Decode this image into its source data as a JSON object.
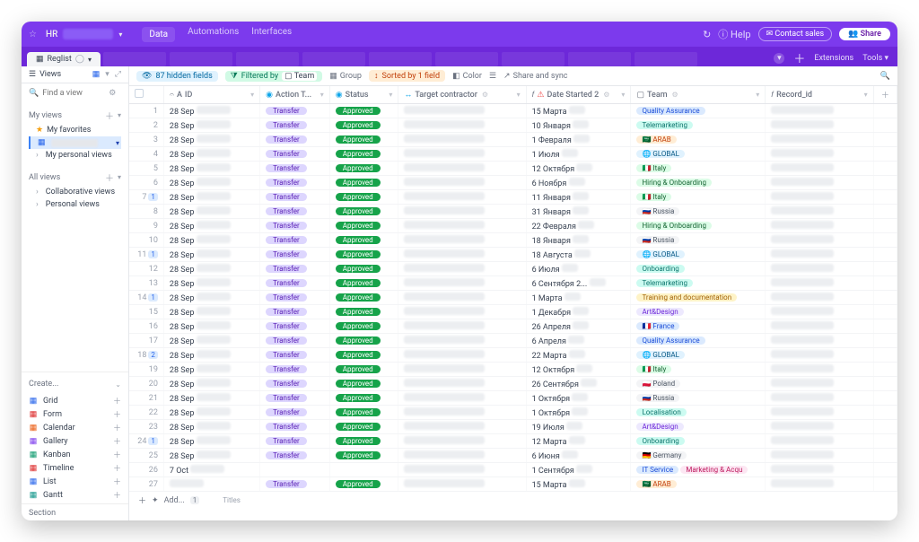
{
  "topbar": {
    "title": "HR",
    "nav": {
      "data": "Data",
      "automations": "Automations",
      "interfaces": "Interfaces"
    },
    "help": "Help",
    "contact": "Contact sales",
    "share": "Share",
    "extensions": "Extensions",
    "tools": "Tools"
  },
  "tabs": {
    "active": "Reglist"
  },
  "sidebar": {
    "views": "Views",
    "find_placeholder": "Find a view",
    "my_views": "My views",
    "my_favorites": "My favorites",
    "my_personal": "My personal views",
    "all_views": "All views",
    "collaborative": "Collaborative views",
    "personal": "Personal views",
    "create": "Create...",
    "list": [
      "Grid",
      "Form",
      "Calendar",
      "Gallery",
      "Kanban",
      "Timeline",
      "List",
      "Gantt"
    ],
    "section": "Section"
  },
  "toolbar": {
    "hidden": "87 hidden fields",
    "filtered": "Filtered by",
    "filtered_field": "Team",
    "group": "Group",
    "sorted": "Sorted by 1 field",
    "color": "Color",
    "share": "Share and sync"
  },
  "columns": {
    "id": "ID",
    "action": "Action T...",
    "status": "Status",
    "target": "Target contractor",
    "date2": "Date Started 2",
    "team": "Team",
    "record": "Record_id"
  },
  "add_label": "Add...",
  "titles_label": "Titles",
  "rows": [
    {
      "n": 1,
      "id": "28 Sep",
      "a": "Transfer",
      "s": "Approved",
      "d": "15 Марта",
      "team": "Quality Assurance",
      "tclass": "team-blue"
    },
    {
      "n": 2,
      "id": "28 Sep",
      "a": "Transfer",
      "s": "Approved",
      "d": "10 Января",
      "team": "Telemarketing",
      "tclass": "team-teal"
    },
    {
      "n": 3,
      "id": "28 Sep",
      "a": "Transfer",
      "s": "Approved",
      "d": "1 Февраля",
      "team": "ARAB",
      "flag": "🇸🇦",
      "tclass": "team-orange"
    },
    {
      "n": 4,
      "id": "28 Sep",
      "a": "Transfer",
      "s": "Approved",
      "d": "1 Июля",
      "team": "GLOBAL",
      "flag": "🌐",
      "tclass": "team-global"
    },
    {
      "n": 5,
      "id": "28 Sep",
      "a": "Transfer",
      "s": "Approved",
      "d": "12 Октября",
      "team": "Italy",
      "flag": "🇮🇹",
      "tclass": "team-green"
    },
    {
      "n": 6,
      "id": "28 Sep",
      "a": "Transfer",
      "s": "Approved",
      "d": "6 Ноября",
      "team": "Hiring & Onboarding",
      "tclass": "team-green"
    },
    {
      "n": 7,
      "b": 1,
      "id": "28 Sep",
      "a": "Transfer",
      "s": "Approved",
      "d": "11 Января",
      "team": "Italy",
      "flag": "🇮🇹",
      "tclass": "team-green"
    },
    {
      "n": 8,
      "id": "28 Sep",
      "a": "Transfer",
      "s": "Approved",
      "d": "31 Января",
      "team": "Russia",
      "flag": "🇷🇺",
      "tclass": "team-gray"
    },
    {
      "n": 9,
      "id": "28 Sep",
      "a": "Transfer",
      "s": "Approved",
      "d": "22 Февраля",
      "team": "Hiring & Onboarding",
      "tclass": "team-green"
    },
    {
      "n": 10,
      "id": "28 Sep",
      "a": "Transfer",
      "s": "Approved",
      "d": "18 Января",
      "team": "Russia",
      "flag": "🇷🇺",
      "tclass": "team-gray"
    },
    {
      "n": 11,
      "b": 1,
      "id": "28 Sep",
      "a": "Transfer",
      "s": "Approved",
      "d": "18 Августа",
      "team": "GLOBAL",
      "flag": "🌐",
      "tclass": "team-global"
    },
    {
      "n": 12,
      "id": "28 Sep",
      "a": "Transfer",
      "s": "Approved",
      "d": "6 Июля",
      "team": "Onboarding",
      "tclass": "team-teal"
    },
    {
      "n": 13,
      "id": "28 Sep",
      "a": "Transfer",
      "s": "Approved",
      "d": "6 Сентября 2...",
      "team": "Telemarketing",
      "tclass": "team-teal"
    },
    {
      "n": 14,
      "b": 1,
      "id": "28 Sep",
      "a": "Transfer",
      "s": "Approved",
      "d": "1 Марта",
      "team": "Training and documentation",
      "tclass": "team-yellow"
    },
    {
      "n": 15,
      "id": "28 Sep",
      "a": "Transfer",
      "s": "Approved",
      "d": "1 Декабря",
      "team": "Art&Design",
      "tclass": "team-purple"
    },
    {
      "n": 16,
      "id": "28 Sep",
      "a": "Transfer",
      "s": "Approved",
      "d": "26 Апреля",
      "team": "France",
      "flag": "🇫🇷",
      "tclass": "team-blue"
    },
    {
      "n": 17,
      "id": "28 Sep",
      "a": "Transfer",
      "s": "Approved",
      "d": "6 Апреля",
      "team": "Quality Assurance",
      "tclass": "team-blue"
    },
    {
      "n": 18,
      "b": 2,
      "id": "28 Sep",
      "a": "Transfer",
      "s": "Approved",
      "d": "22 Марта",
      "team": "GLOBAL",
      "flag": "🌐",
      "tclass": "team-global"
    },
    {
      "n": 19,
      "id": "28 Sep",
      "a": "Transfer",
      "s": "Approved",
      "d": "12 Октября",
      "team": "Italy",
      "flag": "🇮🇹",
      "tclass": "team-green"
    },
    {
      "n": 20,
      "id": "28 Sep",
      "a": "Transfer",
      "s": "Approved",
      "d": "26 Сентября",
      "team": "Poland",
      "flag": "🇵🇱",
      "tclass": "team-gray"
    },
    {
      "n": 21,
      "id": "28 Sep",
      "a": "Transfer",
      "s": "Approved",
      "d": "1 Октября",
      "team": "Russia",
      "flag": "🇷🇺",
      "tclass": "team-gray"
    },
    {
      "n": 22,
      "id": "28 Sep",
      "a": "Transfer",
      "s": "Approved",
      "d": "1 Октября",
      "team": "Localisation",
      "tclass": "team-teal"
    },
    {
      "n": 23,
      "id": "28 Sep",
      "a": "Transfer",
      "s": "Approved",
      "d": "19 Июля",
      "team": "Art&Design",
      "tclass": "team-purple"
    },
    {
      "n": 24,
      "b": 1,
      "id": "28 Sep",
      "a": "Transfer",
      "s": "Approved",
      "d": "12 Марта",
      "team": "Onboarding",
      "tclass": "team-teal"
    },
    {
      "n": 25,
      "id": "28 Sep",
      "a": "Transfer",
      "s": "Approved",
      "d": "6 Июня",
      "team": "Germany",
      "flag": "🇩🇪",
      "tclass": "team-gray"
    },
    {
      "n": 26,
      "id": "7 Oct",
      "a": "",
      "s": "",
      "d": "1 Сентября",
      "team": "IT Service",
      "tclass": "team-blue",
      "team2": "Marketing & Acqu",
      "t2class": "team-pink"
    },
    {
      "n": 27,
      "id": "",
      "a": "Transfer",
      "s": "Approved",
      "d": "15 Марта",
      "team": "ARAB",
      "flag": "🇸🇦",
      "tclass": "team-orange"
    }
  ],
  "icons": {
    "grid": "▦",
    "form": "▤",
    "calendar": "▦",
    "gallery": "▦",
    "kanban": "▥",
    "timeline": "≡",
    "list": "☰",
    "gantt": "▤"
  }
}
